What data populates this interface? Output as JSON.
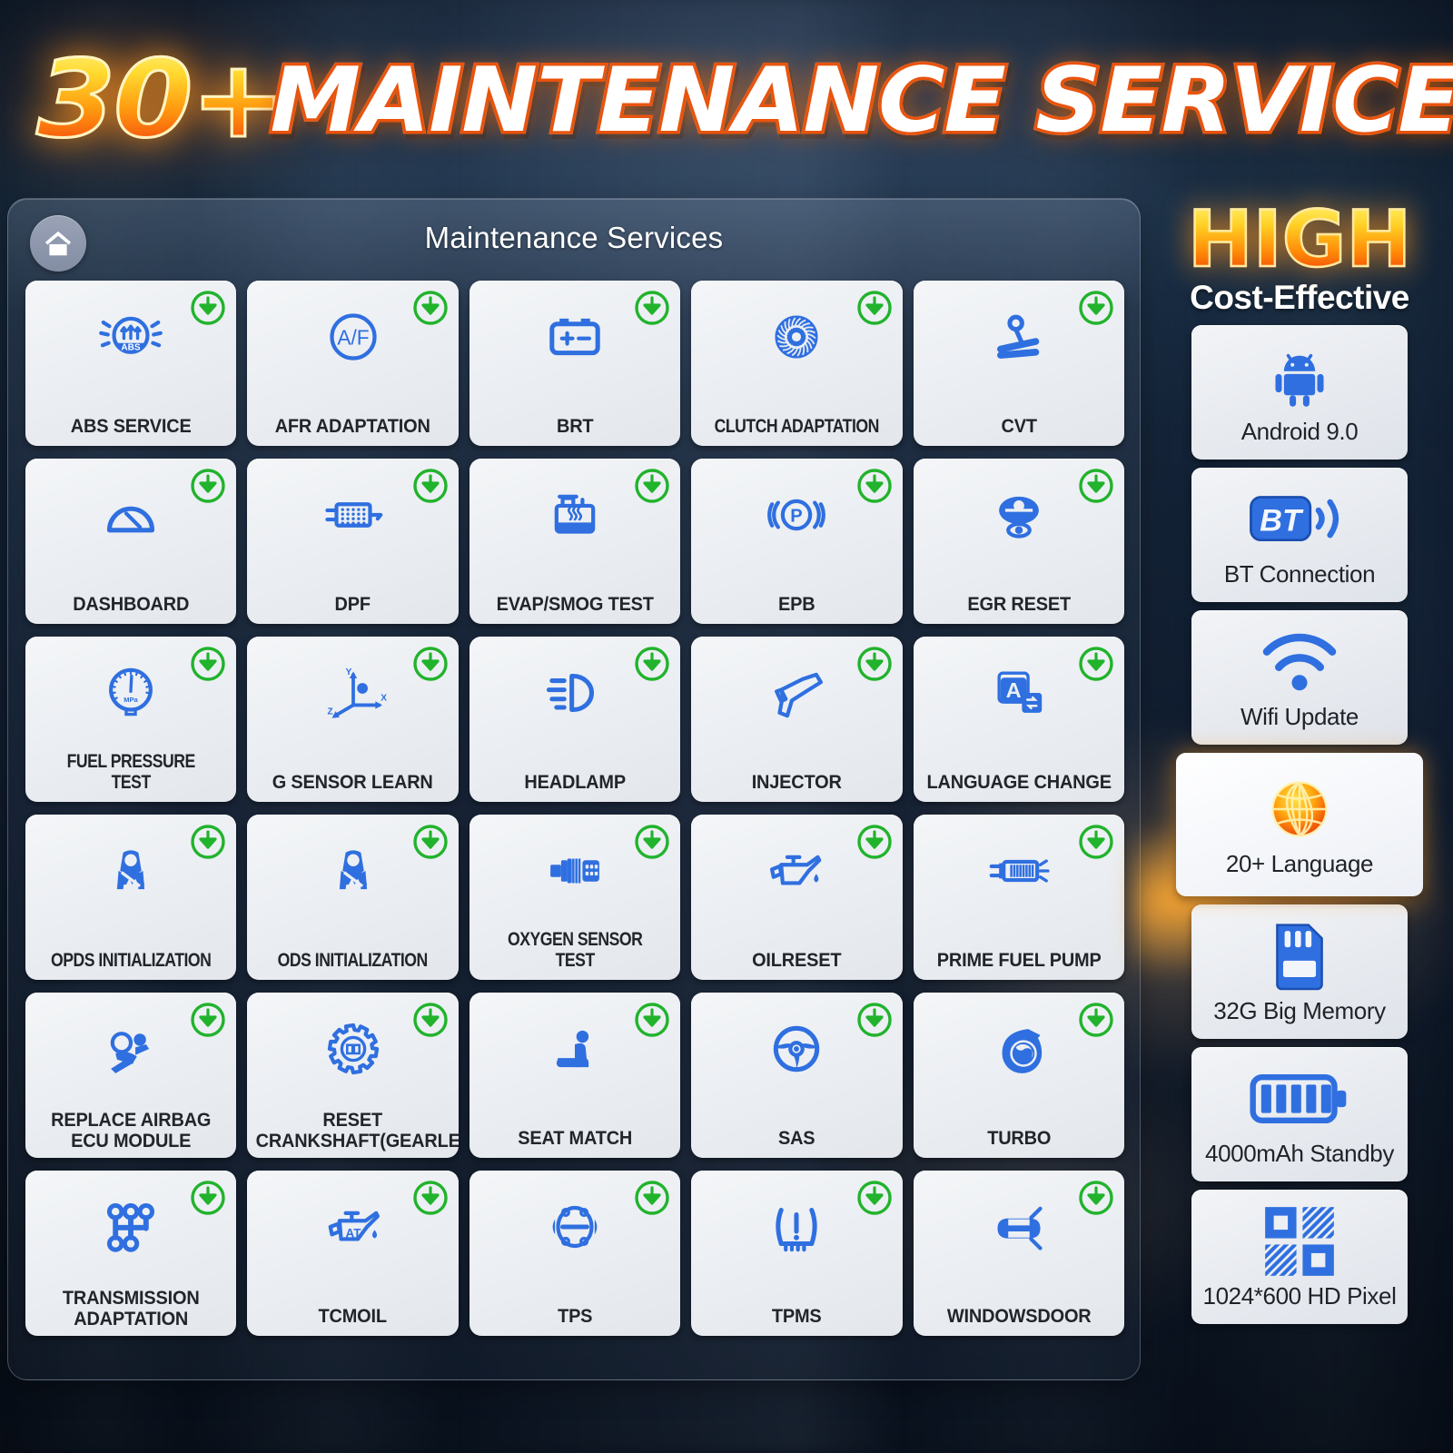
{
  "banner": {
    "count": "30+",
    "title": "MAINTENANCE SERVICES"
  },
  "panel": {
    "title": "Maintenance Services",
    "home_icon": "home-icon",
    "badge_icon": "download-badge-icon"
  },
  "services": [
    {
      "label": "ABS SERVICE",
      "icon": "abs-icon"
    },
    {
      "label": "AFR ADAPTATION",
      "icon": "afr-icon"
    },
    {
      "label": "BRT",
      "icon": "battery-icon"
    },
    {
      "label": "CLUTCH ADAPTATION",
      "icon": "clutch-icon"
    },
    {
      "label": "CVT",
      "icon": "cvt-icon"
    },
    {
      "label": "DASHBOARD",
      "icon": "gauge-icon"
    },
    {
      "label": "DPF",
      "icon": "dpf-icon"
    },
    {
      "label": "EVAP/SMOG TEST",
      "icon": "evap-icon"
    },
    {
      "label": "EPB",
      "icon": "epb-icon"
    },
    {
      "label": "EGR RESET",
      "icon": "egr-icon"
    },
    {
      "label": "FUEL PRESSURE TEST",
      "icon": "pressure-gauge-icon"
    },
    {
      "label": "G SENSOR LEARN",
      "icon": "axes-icon"
    },
    {
      "label": "HEADLAMP",
      "icon": "headlamp-icon"
    },
    {
      "label": "INJECTOR",
      "icon": "injector-icon"
    },
    {
      "label": "LANGUAGE CHANGE",
      "icon": "language-icon"
    },
    {
      "label": "OPDS INITIALIZATION",
      "icon": "occupant-seatbelt-icon"
    },
    {
      "label": "ODS INITIALIZATION",
      "icon": "occupant-seatbelt-icon"
    },
    {
      "label": "OXYGEN SENSOR TEST",
      "icon": "oxygen-sensor-icon"
    },
    {
      "label": "OILRESET",
      "icon": "oil-can-icon"
    },
    {
      "label": "PRIME FUEL PUMP",
      "icon": "fuel-pump-icon"
    },
    {
      "label": "REPLACE AIRBAG ECU MODULE",
      "icon": "airbag-icon"
    },
    {
      "label": "RESET CRANKSHAFT(GEARLEARN)",
      "icon": "gear-book-icon"
    },
    {
      "label": "SEAT MATCH",
      "icon": "seat-icon"
    },
    {
      "label": "SAS",
      "icon": "steering-wheel-icon"
    },
    {
      "label": "TURBO",
      "icon": "turbo-icon"
    },
    {
      "label": "TRANSMISSION ADAPTATION",
      "icon": "gearshift-icon"
    },
    {
      "label": "TCMOIL",
      "icon": "at-oil-can-icon"
    },
    {
      "label": "TPS",
      "icon": "throttle-body-icon"
    },
    {
      "label": "TPMS",
      "icon": "tire-pressure-icon"
    },
    {
      "label": "WINDOWSDOOR",
      "icon": "car-doors-icon"
    }
  ],
  "rail": {
    "headline": "HIGH",
    "subhead": "Cost-Effective",
    "features": [
      {
        "label": "Android 9.0",
        "icon": "android-icon",
        "highlight": false
      },
      {
        "label": "BT Connection",
        "icon": "bluetooth-icon",
        "highlight": false
      },
      {
        "label": "Wifi Update",
        "icon": "wifi-icon",
        "highlight": false
      },
      {
        "label": "20+ Language",
        "icon": "globe-icon",
        "highlight": true
      },
      {
        "label": "32G Big Memory",
        "icon": "sd-card-icon",
        "highlight": false
      },
      {
        "label": "4000mAh Standby",
        "icon": "battery-icon",
        "highlight": false
      },
      {
        "label": "1024*600 HD Pixel",
        "icon": "pixel-grid-icon",
        "highlight": false
      }
    ]
  },
  "colors": {
    "accent_blue": "#2f6fe0",
    "badge_green": "#22b32a",
    "banner_orange": "#ef5a10",
    "card_bg": "#eceff3",
    "panel_title": "#ffffff"
  }
}
